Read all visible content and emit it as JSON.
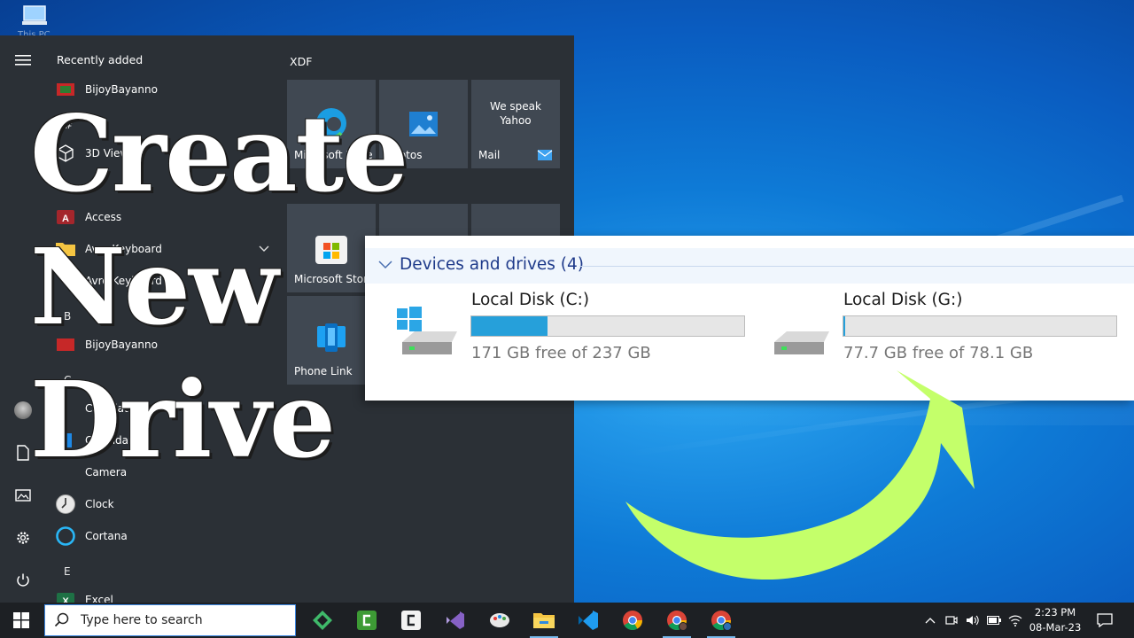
{
  "desktop": {
    "icon_label": "This PC"
  },
  "start_menu": {
    "list_header": "Recently added",
    "apps": [
      {
        "label": "BijoyBayanno",
        "icon": "red-app-icon"
      },
      {
        "label": "3D Viewer",
        "icon": "cube-icon"
      },
      {
        "label": "Access",
        "icon": "access-icon"
      },
      {
        "label": "Avro Keyboard",
        "icon": "folder-icon"
      },
      {
        "label": "Avro Keyboard",
        "icon": "keyboard-icon"
      },
      {
        "label": "BijoyBayanno",
        "icon": "red-app-icon"
      },
      {
        "label": "Calculator",
        "icon": "calculator-icon"
      },
      {
        "label": "Calendar",
        "icon": "calendar-icon"
      },
      {
        "label": "Camera",
        "icon": "camera-icon"
      },
      {
        "label": "Clock",
        "icon": "clock-icon"
      },
      {
        "label": "Cortana",
        "icon": "cortana-icon"
      },
      {
        "label": "Excel",
        "icon": "excel-icon"
      }
    ],
    "letters": [
      "#",
      "A",
      "B",
      "C",
      "E"
    ],
    "tile_group": "XDF",
    "tiles": [
      {
        "label": "Microsoft Edge",
        "icon": "edge-icon"
      },
      {
        "label": "Photos",
        "icon": "photos-icon"
      },
      {
        "label": "Mail",
        "headline": "We speak Yahoo",
        "icon": "mail-icon"
      },
      {
        "label": "Microsoft Store",
        "icon": "store-icon"
      },
      {
        "label": "Phone Link",
        "icon": "phone-link-icon"
      }
    ]
  },
  "explorer": {
    "group_title": "Devices and drives (4)",
    "drives": [
      {
        "name": "Local Disk (C:)",
        "free_text": "171 GB free of 237 GB",
        "used_fraction": 0.28
      },
      {
        "name": "Local Disk (G:)",
        "free_text": "77.7 GB free of 78.1 GB",
        "used_fraction": 0.005
      }
    ]
  },
  "overlay": {
    "line1": "Create",
    "line2": "New",
    "line3": "Drive",
    "arrow_color": "#c4ff6a"
  },
  "taskbar": {
    "search_placeholder": "Type here to search",
    "apps": [
      "gitkraken-icon",
      "camtasia-icon",
      "camtasia-rec-icon",
      "visual-studio-icon",
      "paint-icon",
      "file-explorer-icon",
      "vscode-icon",
      "chrome-icon",
      "chrome-profile-icon",
      "chrome-profile-2-icon"
    ],
    "time": "2:23 PM",
    "date": "08-Mar-23"
  },
  "colors": {
    "accent": "#26a0da",
    "start_bg": "#2b3036",
    "taskbar_bg": "#1d2024"
  }
}
